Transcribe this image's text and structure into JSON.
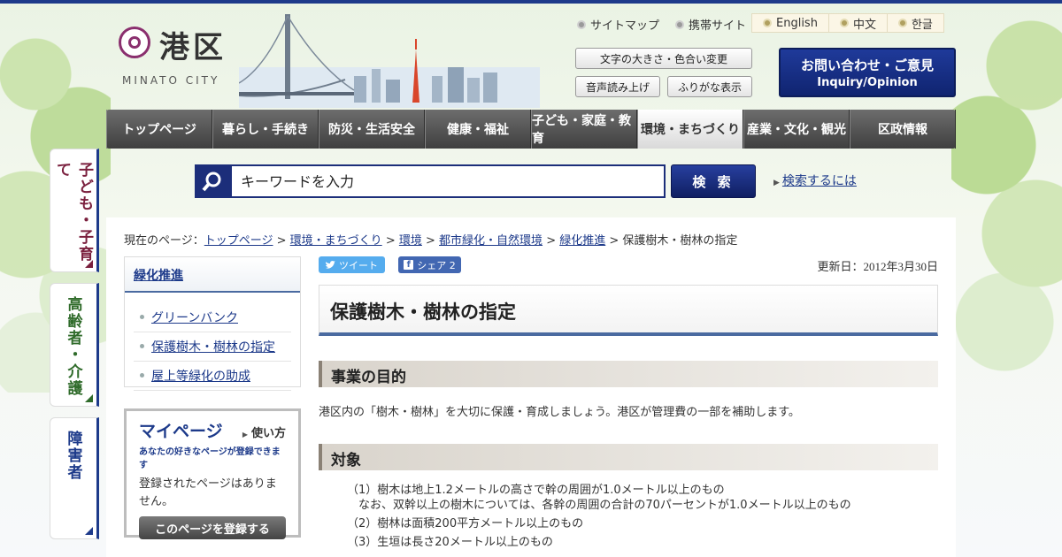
{
  "header": {
    "logo_name": "港区",
    "logo_sub": "MINATO CITY",
    "util_links": [
      "サイトマップ",
      "携帯サイト"
    ],
    "lang_links": [
      "English",
      "中文",
      "한글"
    ],
    "font_size_btn": "文字の大きさ・色合い変更",
    "voice_btn": "音声読み上げ",
    "furigana_btn": "ふりがな表示",
    "inquiry_ja": "お問い合わせ・ご意見",
    "inquiry_en": "Inquiry/Opinion"
  },
  "nav": {
    "items": [
      "トップページ",
      "暮らし・手続き",
      "防災・生活安全",
      "健康・福祉",
      "子ども・家庭・教育",
      "環境・まちづくり",
      "産業・文化・観光",
      "区政情報"
    ],
    "active_index": 5
  },
  "search": {
    "placeholder": "キーワードを入力",
    "button": "検 索",
    "help": "検索するには"
  },
  "side_tabs": [
    {
      "label": "子ども・子育て",
      "color": "#7a1f3d"
    },
    {
      "label": "高齢者・介護",
      "color": "#2f6b2a"
    },
    {
      "label": "障害者",
      "color": "#1d3a8a"
    }
  ],
  "breadcrumb": {
    "prefix": "現在のページ：",
    "links": [
      "トップページ",
      "環境・まちづくり",
      "環境",
      "都市緑化・自然環境",
      "緑化推進"
    ],
    "current": "保護樹木・樹林の指定"
  },
  "local_nav": {
    "heading": "緑化推進",
    "items": [
      "グリーンバンク",
      "保護樹木・樹林の指定",
      "屋上等緑化の助成"
    ]
  },
  "mypage": {
    "title": "マイページ",
    "howto": "使い方",
    "sub": "あなたの好きなページが登録できます",
    "msg": "登録されたページはありません。",
    "register": "このページを登録する"
  },
  "social": {
    "tweet": "ツイート",
    "share": "シェア 2"
  },
  "content": {
    "updated": "更新日：2012年3月30日",
    "title": "保護樹木・樹林の指定",
    "h2_purpose": "事業の目的",
    "purpose_text": "港区内の「樹木・樹林」を大切に保護・育成しましょう。港区が管理費の一部を補助します。",
    "h2_target": "対象",
    "targets": [
      "（1）樹木は地上1.2メートルの高さで幹の周囲が1.0メートル以上のもの",
      "　なお、双幹以上の樹木については、各幹の周囲の合計の70パーセントが1.0メートル以上のもの",
      "（2）樹林は面積200平方メートル以上のもの",
      "（3）生垣は長さ20メートル以上のもの"
    ]
  }
}
